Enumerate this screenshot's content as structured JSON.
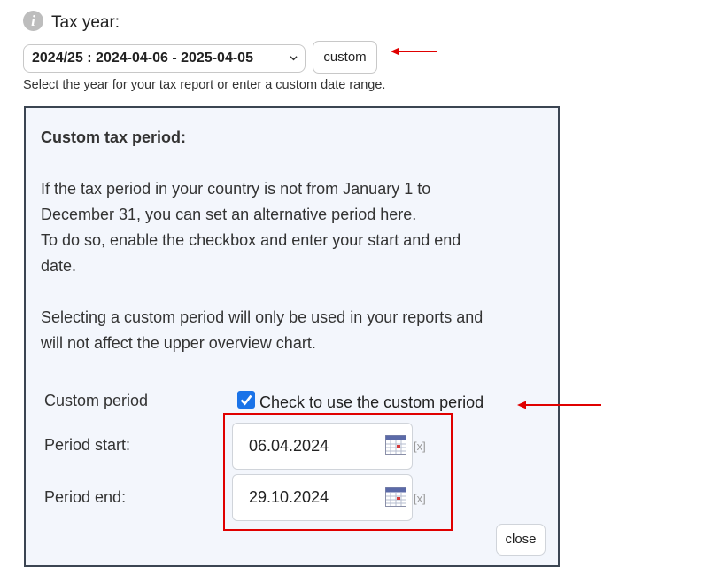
{
  "tax_year": {
    "label": "Tax year:",
    "selected": "2024/25 : 2024-04-06 - 2025-04-05",
    "custom_button": "custom",
    "hint": "Select the year for your tax report or enter a custom date range."
  },
  "panel": {
    "title": "Custom tax period:",
    "paragraph1_lines": [
      "If the tax period in your country is not from January 1 to",
      "December 31, you can set an alternative period here.",
      "To do so, enable the checkbox and enter your start and end",
      "date."
    ],
    "paragraph2_lines": [
      "Selecting a custom period will only be used in your reports and",
      "will not affect the upper overview chart."
    ],
    "custom_period_label": "Custom period",
    "checkbox_label": "Check to use the custom period",
    "checkbox_checked": true,
    "period_start_label": "Period start:",
    "period_start_value": "06.04.2024",
    "period_end_label": "Period end:",
    "period_end_value": "29.10.2024",
    "clear_label": "[x]",
    "close_button": "close"
  },
  "icons": [
    "info-icon",
    "chevron-down-icon",
    "calendar-icon",
    "checkmark-icon"
  ],
  "colors": {
    "accent": "#1a73e8",
    "annotation_red": "#e00000",
    "panel_bg": "#f3f6fc",
    "panel_border": "#3b4552"
  }
}
